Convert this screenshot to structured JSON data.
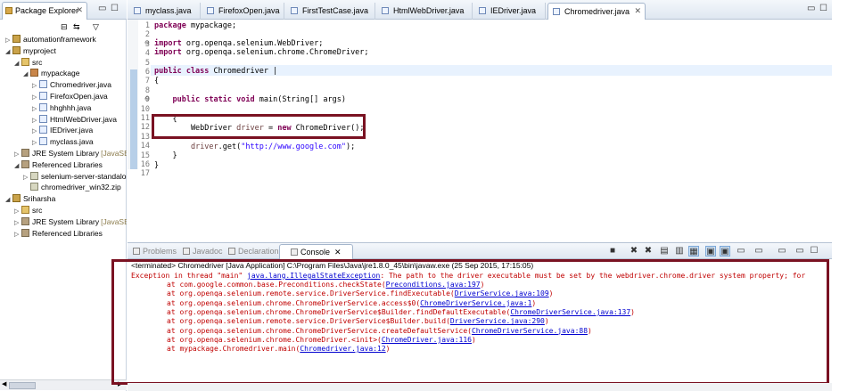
{
  "package_explorer": {
    "title": "Package Explorer",
    "tree": [
      {
        "label": "automationframework",
        "icon": "project-icon",
        "indent": 0,
        "twisty": "▷"
      },
      {
        "label": "myproject",
        "icon": "project-icon",
        "indent": 0,
        "twisty": "◢"
      },
      {
        "label": "src",
        "icon": "source-folder-icon",
        "indent": 1,
        "twisty": "◢"
      },
      {
        "label": "mypackage",
        "icon": "package-icon",
        "indent": 2,
        "twisty": "◢"
      },
      {
        "label": "Chromedriver.java",
        "icon": "java-file-icon",
        "indent": 3,
        "twisty": "▷"
      },
      {
        "label": "FirefoxOpen.java",
        "icon": "java-file-icon",
        "indent": 3,
        "twisty": "▷"
      },
      {
        "label": "hhghhh.java",
        "icon": "java-file-icon",
        "indent": 3,
        "twisty": "▷"
      },
      {
        "label": "HtmlWebDriver.java",
        "icon": "java-file-icon",
        "indent": 3,
        "twisty": "▷"
      },
      {
        "label": "IEDriver.java",
        "icon": "java-file-icon",
        "indent": 3,
        "twisty": "▷"
      },
      {
        "label": "myclass.java",
        "icon": "java-file-icon",
        "indent": 3,
        "twisty": "▷"
      },
      {
        "label": "JRE System Library",
        "suffix": "[JavaSE-1.8]",
        "icon": "library-icon",
        "indent": 1,
        "twisty": "▷"
      },
      {
        "label": "Referenced Libraries",
        "icon": "library-icon",
        "indent": 1,
        "twisty": "◢"
      },
      {
        "label": "selenium-server-standalone",
        "icon": "jar-icon",
        "indent": 2,
        "twisty": "▷"
      },
      {
        "label": "chromedriver_win32.zip",
        "icon": "jar-icon",
        "indent": 2,
        "twisty": ""
      },
      {
        "label": "Sriharsha",
        "icon": "project-icon",
        "indent": 0,
        "twisty": "◢"
      },
      {
        "label": "src",
        "icon": "source-folder-icon",
        "indent": 1,
        "twisty": "▷"
      },
      {
        "label": "JRE System Library",
        "suffix": "[JavaSE-1.8]",
        "icon": "library-icon",
        "indent": 1,
        "twisty": "▷"
      },
      {
        "label": "Referenced Libraries",
        "icon": "library-icon",
        "indent": 1,
        "twisty": "▷"
      }
    ]
  },
  "editor": {
    "tabs": [
      {
        "label": "myclass.java",
        "active": false
      },
      {
        "label": "FirefoxOpen.java",
        "active": false
      },
      {
        "label": "FirstTestCase.java",
        "active": false
      },
      {
        "label": "HtmlWebDriver.java",
        "active": false
      },
      {
        "label": "IEDriver.java",
        "active": false
      },
      {
        "label": "Chromedriver.java",
        "active": true
      }
    ],
    "line_numbers": [
      "1",
      "2",
      "3",
      "4",
      "5",
      "6",
      "7",
      "8",
      "9",
      "10",
      "11",
      "12",
      "13",
      "14",
      "15",
      "16",
      "17"
    ],
    "code": {
      "l1": "package mypackage;",
      "l3": "import org.openqa.selenium.WebDriver;",
      "l4": "import org.openqa.selenium.chrome.ChromeDriver;",
      "l6": "public class Chromedriver ",
      "l7": "{",
      "l9": "public static void main(String[] args)",
      "l11": "{",
      "l12a": "WebDriver ",
      "l12b": "driver",
      "l12c": " = ",
      "l12d": "new",
      "l12e": " ChromeDriver();",
      "l14a": "driver",
      "l14b": ".get(",
      "l14c": "\"http://www.google.com\"",
      "l14d": ");",
      "l15": "}",
      "l16": "}"
    }
  },
  "console": {
    "tabs": [
      {
        "label": "Problems",
        "active": false
      },
      {
        "label": "Javadoc",
        "active": false
      },
      {
        "label": "Declaration",
        "active": false
      },
      {
        "label": "Console",
        "active": true
      }
    ],
    "terminated": "<terminated> Chromedriver [Java Application] C:\\Program Files\\Java\\jre1.8.0_45\\bin\\javaw.exe (25 Sep 2015, 17:15:05)",
    "exception_prefix": "Exception in thread \"main\" ",
    "exception_class": "java.lang.IllegalStateException",
    "exception_message": ": The path to the driver executable must be set by the webdriver.chrome.driver system property; for",
    "stack": [
      {
        "text": "at com.google.common.base.Preconditions.checkState(",
        "link": "Preconditions.java:197",
        "end": ")"
      },
      {
        "text": "at org.openqa.selenium.remote.service.DriverService.findExecutable(",
        "link": "DriverService.java:109",
        "end": ")"
      },
      {
        "text": "at org.openqa.selenium.chrome.ChromeDriverService.access$0(",
        "link": "ChromeDriverService.java:1",
        "end": ")"
      },
      {
        "text": "at org.openqa.selenium.chrome.ChromeDriverService$Builder.findDefaultExecutable(",
        "link": "ChromeDriverService.java:137",
        "end": ")"
      },
      {
        "text": "at org.openqa.selenium.remote.service.DriverService$Builder.build(",
        "link": "DriverService.java:290",
        "end": ")"
      },
      {
        "text": "at org.openqa.selenium.chrome.ChromeDriverService.createDefaultService(",
        "link": "ChromeDriverService.java:88",
        "end": ")"
      },
      {
        "text": "at org.openqa.selenium.chrome.ChromeDriver.<init>(",
        "link": "ChromeDriver.java:116",
        "end": ")"
      },
      {
        "text": "at mypackage.Chromedriver.main(",
        "link": "Chromedriver.java:12",
        "end": ")"
      }
    ]
  },
  "colors": {
    "highlight_box": "#7a1222",
    "keyword": "#7f0055",
    "error_text": "#c00000",
    "link": "#0000d0"
  }
}
